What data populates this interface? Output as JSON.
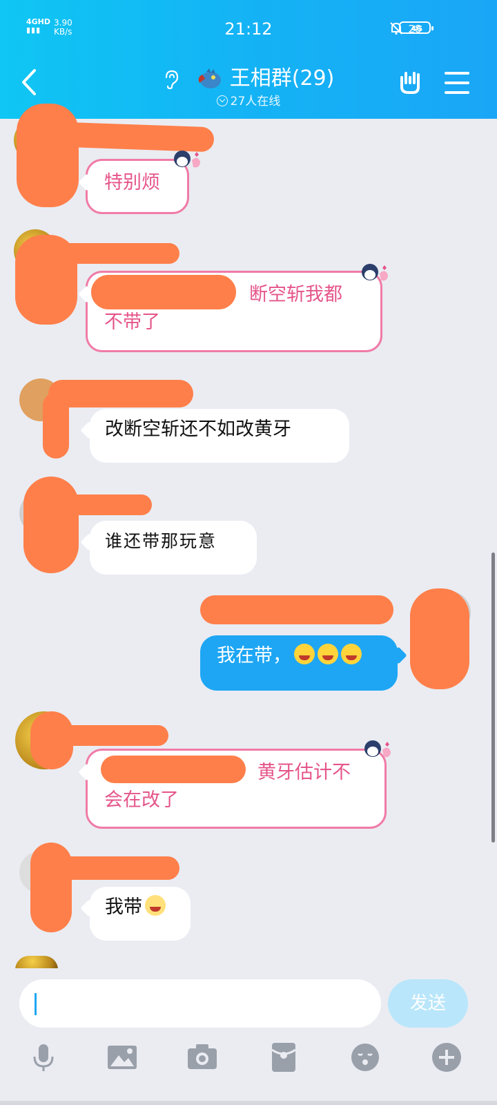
{
  "status_bar": {
    "network": "4GHD",
    "speed_value": "3.90",
    "speed_unit": "KB/s",
    "time": "21:12",
    "signal_right": "4G",
    "battery": "28"
  },
  "header": {
    "group_name": "王相群(29)",
    "online": "27人在线"
  },
  "messages": [
    {
      "text": "特别烦"
    },
    {
      "text_line1": "断空斩我都",
      "text_line2": "不带了"
    },
    {
      "text": "改断空斩还不如改黄牙"
    },
    {
      "text": "谁还带那玩意"
    },
    {
      "text": "我在带，"
    },
    {
      "text_line1": "黄牙估计不",
      "text_line2": "会在改了"
    },
    {
      "text": "我带"
    }
  ],
  "input": {
    "placeholder": "",
    "send_label": "发送"
  },
  "colors": {
    "header_start": "#0fc6f4",
    "header_end": "#1aa6f6",
    "bubble_blue": "#1ea6f4",
    "bubble_pink_border": "#f07ba6",
    "pink_text": "#e5558a"
  },
  "icons": [
    "back-icon",
    "ear-icon",
    "dragon-icon",
    "hand-icon",
    "menu-icon",
    "voice-icon",
    "image-icon",
    "camera-icon",
    "red-packet-icon",
    "emoji-icon",
    "plus-icon"
  ]
}
